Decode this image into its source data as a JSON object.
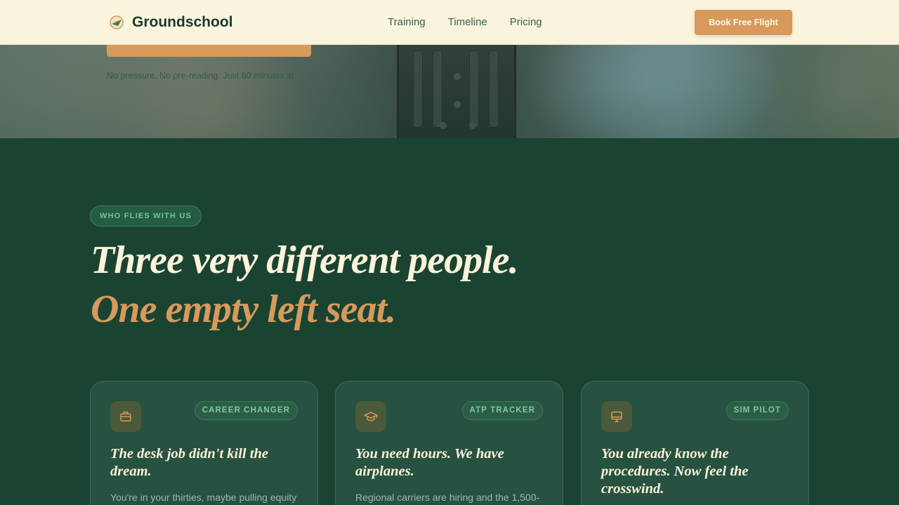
{
  "header": {
    "brand": "Groundschool",
    "nav": [
      "Training",
      "Timeline",
      "Pricing"
    ],
    "cta": "Book Free Flight"
  },
  "hero": {
    "note": "No pressure. No pre-reading. Just 60 minutes in"
  },
  "section": {
    "pill": "WHO FLIES WITH US",
    "heading_line1": "Three very different people.",
    "heading_line2": "One empty left seat."
  },
  "cards": [
    {
      "icon": "briefcase-icon",
      "tag": "CAREER CHANGER",
      "title": "The desk job didn't kill the dream.",
      "body": "You're in your thirties, maybe pulling equity"
    },
    {
      "icon": "graduation-cap-icon",
      "tag": "ATP TRACKER",
      "title": "You need hours. We have airplanes.",
      "body": "Regional carriers are hiring and the 1,500-"
    },
    {
      "icon": "monitor-icon",
      "tag": "SIM PILOT",
      "title": "You already know the procedures. Now feel the crosswind.",
      "body": ""
    }
  ],
  "colors": {
    "background": "#1b4332",
    "accent": "#d69a5c",
    "cream": "#fbf3d9",
    "header_bg": "#faf4dd"
  }
}
